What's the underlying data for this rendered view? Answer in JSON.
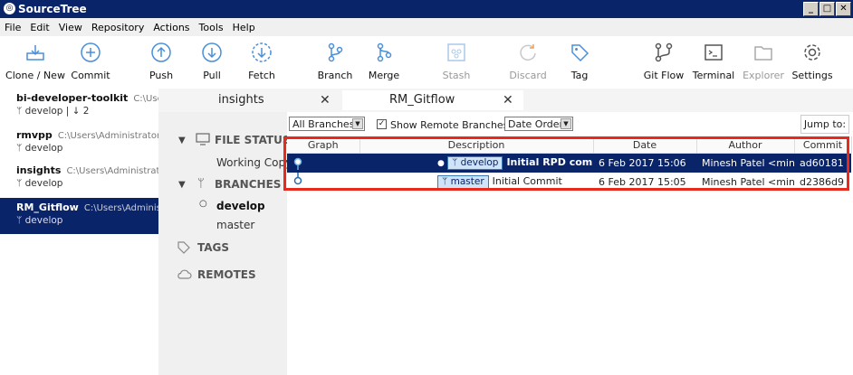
{
  "window": {
    "title": "SourceTree",
    "buttons": [
      "_",
      "□",
      "✕"
    ]
  },
  "menu": [
    "File",
    "Edit",
    "View",
    "Repository",
    "Actions",
    "Tools",
    "Help"
  ],
  "toolbar": [
    {
      "label": "Clone / New",
      "icon": "clone-icon"
    },
    {
      "label": "Commit",
      "icon": "commit-plus-icon"
    },
    {
      "label": "Push",
      "icon": "push-arrow-up-icon"
    },
    {
      "label": "Pull",
      "icon": "pull-arrow-down-icon"
    },
    {
      "label": "Fetch",
      "icon": "fetch-arrow-down-icon"
    },
    {
      "label": "Branch",
      "icon": "branch-icon"
    },
    {
      "label": "Merge",
      "icon": "merge-icon"
    },
    {
      "label": "Stash",
      "icon": "stash-icon"
    },
    {
      "label": "Discard",
      "icon": "discard-icon"
    },
    {
      "label": "Tag",
      "icon": "tag-icon"
    },
    {
      "label": "Git Flow",
      "icon": "git-flow-icon"
    },
    {
      "label": "Terminal",
      "icon": "terminal-icon"
    },
    {
      "label": "Explorer",
      "icon": "explorer-icon"
    },
    {
      "label": "Settings",
      "icon": "gear-icon"
    }
  ],
  "repos": [
    {
      "name": "bi-developer-toolkit",
      "path": "C:\\Users\\Administrator",
      "branch": "develop | ↓ 2"
    },
    {
      "name": "rmvpp",
      "path": "C:\\Users\\Administrator",
      "branch": "develop"
    },
    {
      "name": "insights",
      "path": "C:\\Users\\Administrator",
      "branch": "develop"
    },
    {
      "name": "RM_Gitflow",
      "path": "C:\\Users\\Administrator",
      "branch": "develop"
    }
  ],
  "tabs": [
    {
      "label": "insights",
      "close": "✕"
    },
    {
      "label": "RM_Gitflow",
      "close": "✕"
    }
  ],
  "sidebar": {
    "file_status": "FILE STATUS",
    "working_copy": "Working Copy",
    "branches": "BRANCHES",
    "branch_items": [
      "develop",
      "master"
    ],
    "tags": "TAGS",
    "remotes": "REMOTES"
  },
  "filters": {
    "branches": "All Branches",
    "show_remote": "Show Remote Branches",
    "order": "Date Order",
    "jump": "Jump to:"
  },
  "table": {
    "headers": [
      "Graph",
      "Description",
      "Date",
      "Author",
      "Commit"
    ],
    "rows": [
      {
        "branch": "develop",
        "description": "Initial RPD commit.",
        "date": "6 Feb 2017 15:06",
        "author": "Minesh Patel <mines",
        "commit": "ad60181"
      },
      {
        "branch": "master",
        "description": "Initial Commit",
        "date": "6 Feb 2017 15:05",
        "author": "Minesh Patel <mines",
        "commit": "d2386d9"
      }
    ]
  },
  "colors": {
    "selection": "#0a246a",
    "highlight": "#e82a1d",
    "branch_tag_bg": "#cfe4f7"
  }
}
